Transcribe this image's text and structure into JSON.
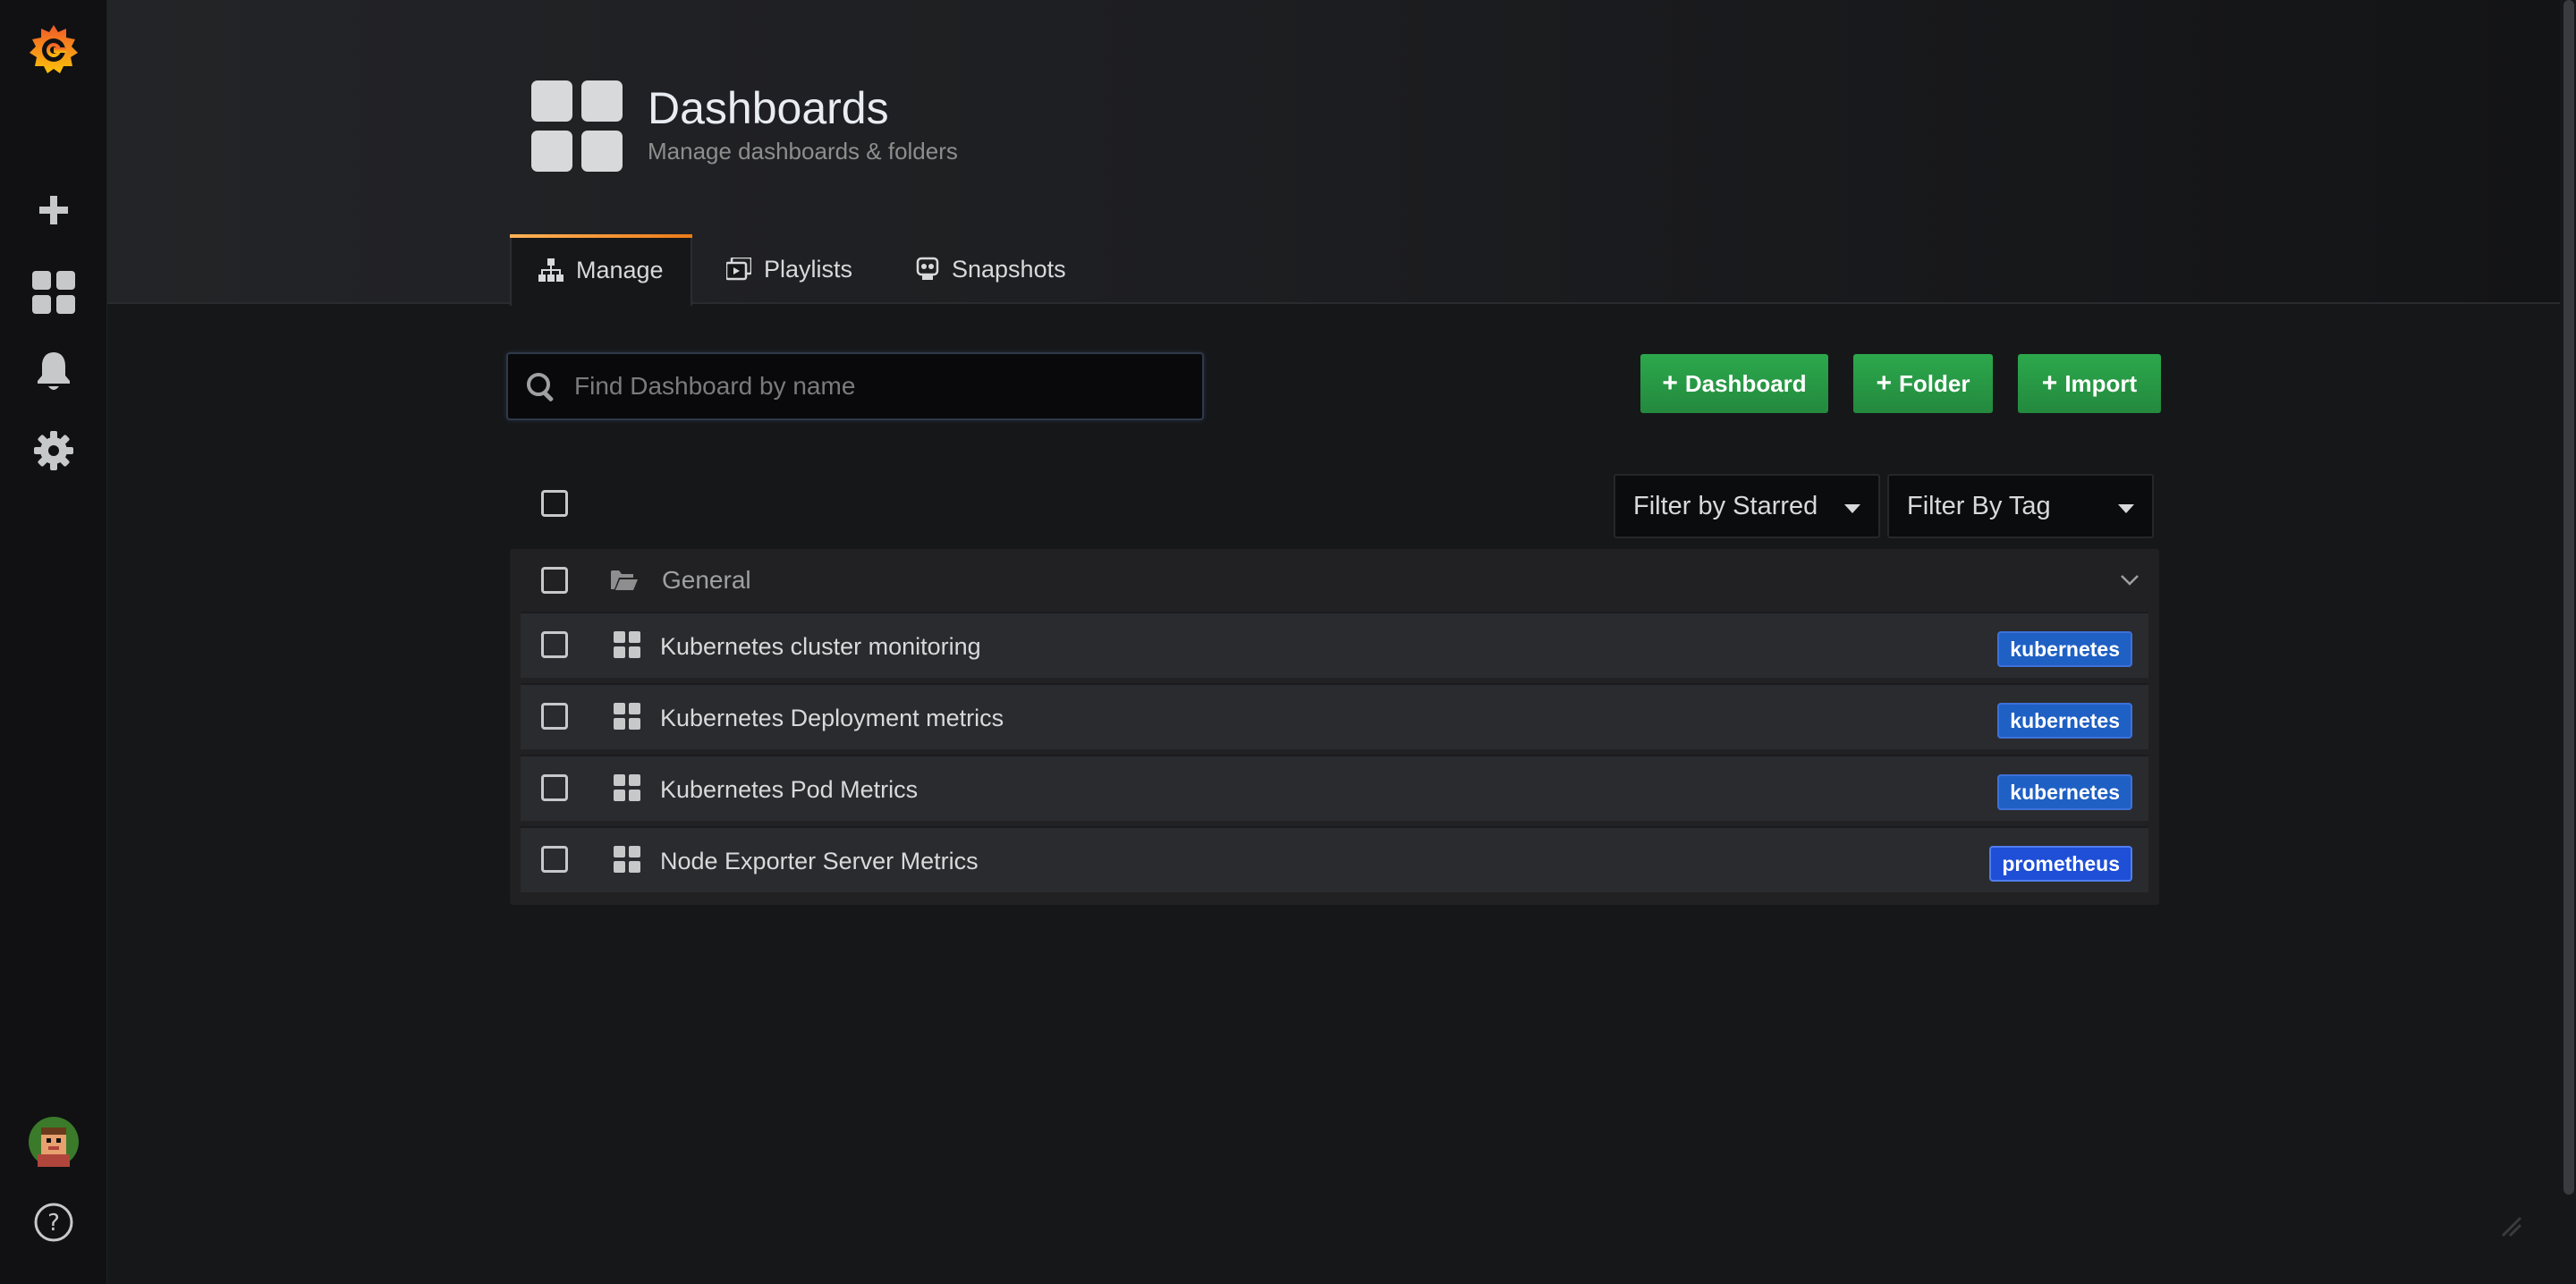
{
  "header": {
    "title": "Dashboards",
    "subtitle": "Manage dashboards & folders"
  },
  "tabs": [
    {
      "label": "Manage",
      "icon": "sitemap-icon",
      "active": true
    },
    {
      "label": "Playlists",
      "icon": "playlist-icon",
      "active": false
    },
    {
      "label": "Snapshots",
      "icon": "snapshot-icon",
      "active": false
    }
  ],
  "search": {
    "placeholder": "Find Dashboard by name",
    "value": ""
  },
  "actions": {
    "dashboard_label": "Dashboard",
    "folder_label": "Folder",
    "import_label": "Import"
  },
  "filters": {
    "starred_label": "Filter by Starred",
    "tag_label": "Filter By Tag"
  },
  "folder": {
    "name": "General",
    "expanded": true
  },
  "dashboards": [
    {
      "title": "Kubernetes cluster monitoring",
      "tag": "kubernetes",
      "tag_color": "#1f60c4"
    },
    {
      "title": "Kubernetes Deployment metrics",
      "tag": "kubernetes",
      "tag_color": "#1f60c4"
    },
    {
      "title": "Kubernetes Pod Metrics",
      "tag": "kubernetes",
      "tag_color": "#1f60c4"
    },
    {
      "title": "Node Exporter Server Metrics",
      "tag": "prometheus",
      "tag_color": "#1f4fd6"
    }
  ],
  "colors": {
    "accent": "#eb7b18",
    "primary_button": "#299c46",
    "tag_blue": "#1f60c4",
    "tag_border": "#3d71d9"
  }
}
